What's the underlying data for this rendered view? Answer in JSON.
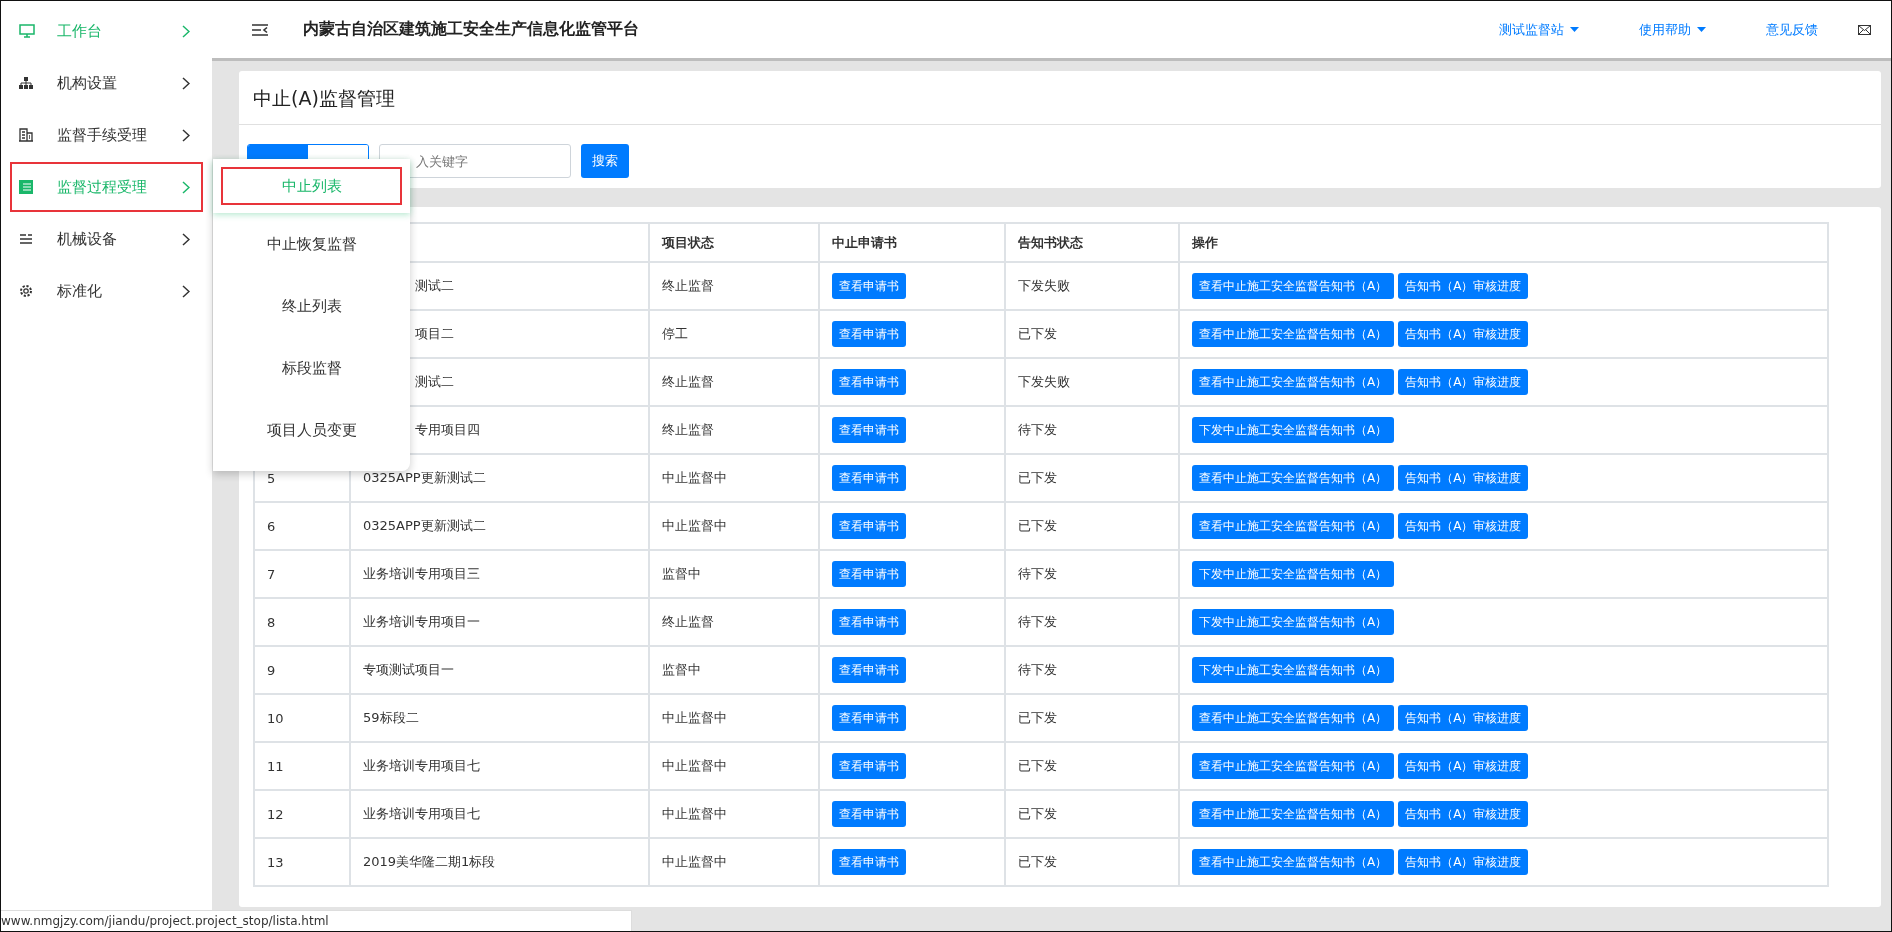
{
  "header": {
    "title": "内蒙古自治区建筑施工安全生产信息化监管平台",
    "menus": [
      {
        "label": "测试监督站",
        "dropdown": true
      },
      {
        "label": "使用帮助",
        "dropdown": true
      },
      {
        "label": "意见反馈",
        "dropdown": false
      }
    ]
  },
  "sidebar": {
    "items": [
      {
        "label": "工作台",
        "selected": true,
        "outlined": false
      },
      {
        "label": "机构设置",
        "selected": false,
        "outlined": false
      },
      {
        "label": "监督手续受理",
        "selected": false,
        "outlined": false
      },
      {
        "label": "监督过程受理",
        "selected": true,
        "outlined": true
      },
      {
        "label": "机械设备",
        "selected": false,
        "outlined": false
      },
      {
        "label": "标准化",
        "selected": false,
        "outlined": false
      }
    ]
  },
  "submenu": {
    "items": [
      {
        "label": "中止列表",
        "selected": true,
        "outlined": true
      },
      {
        "label": "中止恢复监督",
        "selected": false,
        "outlined": false
      },
      {
        "label": "终止列表",
        "selected": false,
        "outlined": false
      },
      {
        "label": "标段监督",
        "selected": false,
        "outlined": false
      },
      {
        "label": "项目人员变更",
        "selected": false,
        "outlined": false
      }
    ]
  },
  "page": {
    "title": "中止(A)监督管理"
  },
  "filter_tabs": [
    {
      "selected": true
    },
    {
      "selected": false
    }
  ],
  "search": {
    "placeholder": "入关键字",
    "button": "搜索"
  },
  "table": {
    "columns": [
      "项目状态",
      "中止申请书",
      "告知书状态",
      "操作"
    ],
    "rows": [
      {
        "name": "测试二",
        "status": "终止监督",
        "apply": "查看申请书",
        "notice": "下发失败",
        "actions": [
          "查看中止施工安全监督告知书（A）",
          "告知书（A）审核进度"
        ]
      },
      {
        "name": "项目二",
        "status": "停工",
        "apply": "查看申请书",
        "notice": "已下发",
        "actions": [
          "查看中止施工安全监督告知书（A）",
          "告知书（A）审核进度"
        ]
      },
      {
        "name": "测试二",
        "status": "终止监督",
        "apply": "查看申请书",
        "notice": "下发失败",
        "actions": [
          "查看中止施工安全监督告知书（A）",
          "告知书（A）审核进度"
        ]
      },
      {
        "name": "专用项目四",
        "status": "终止监督",
        "apply": "查看申请书",
        "notice": "待下发",
        "actions": [
          "下发中止施工安全监督告知书（A）"
        ]
      },
      {
        "index": "5",
        "name": "0325APP更新测试二",
        "status": "中止监督中",
        "apply": "查看申请书",
        "notice": "已下发",
        "actions": [
          "查看中止施工安全监督告知书（A）",
          "告知书（A）审核进度"
        ]
      },
      {
        "index": "6",
        "name": "0325APP更新测试二",
        "status": "中止监督中",
        "apply": "查看申请书",
        "notice": "已下发",
        "actions": [
          "查看中止施工安全监督告知书（A）",
          "告知书（A）审核进度"
        ]
      },
      {
        "index": "7",
        "name": "业务培训专用项目三",
        "status": "监督中",
        "apply": "查看申请书",
        "notice": "待下发",
        "actions": [
          "下发中止施工安全监督告知书（A）"
        ]
      },
      {
        "index": "8",
        "name": "业务培训专用项目一",
        "status": "终止监督",
        "apply": "查看申请书",
        "notice": "待下发",
        "actions": [
          "下发中止施工安全监督告知书（A）"
        ]
      },
      {
        "index": "9",
        "name": "专项测试项目一",
        "status": "监督中",
        "apply": "查看申请书",
        "notice": "待下发",
        "actions": [
          "下发中止施工安全监督告知书（A）"
        ]
      },
      {
        "index": "10",
        "name": "59标段二",
        "status": "中止监督中",
        "apply": "查看申请书",
        "notice": "已下发",
        "actions": [
          "查看中止施工安全监督告知书（A）",
          "告知书（A）审核进度"
        ]
      },
      {
        "index": "11",
        "name": "业务培训专用项目七",
        "status": "中止监督中",
        "apply": "查看申请书",
        "notice": "已下发",
        "actions": [
          "查看中止施工安全监督告知书（A）",
          "告知书（A）审核进度"
        ]
      },
      {
        "index": "12",
        "name": "业务培训专用项目七",
        "status": "中止监督中",
        "apply": "查看申请书",
        "notice": "已下发",
        "actions": [
          "查看中止施工安全监督告知书（A）",
          "告知书（A）审核进度"
        ]
      },
      {
        "index": "13",
        "name": "2019美华隆二期1标段",
        "status": "中止监督中",
        "apply": "查看申请书",
        "notice": "已下发",
        "actions": [
          "查看中止施工安全监督告知书（A）",
          "告知书（A）审核进度"
        ]
      }
    ]
  },
  "status_bar": {
    "url": "www.nmgjzy.com/jiandu/project.project_stop/lista.html"
  }
}
